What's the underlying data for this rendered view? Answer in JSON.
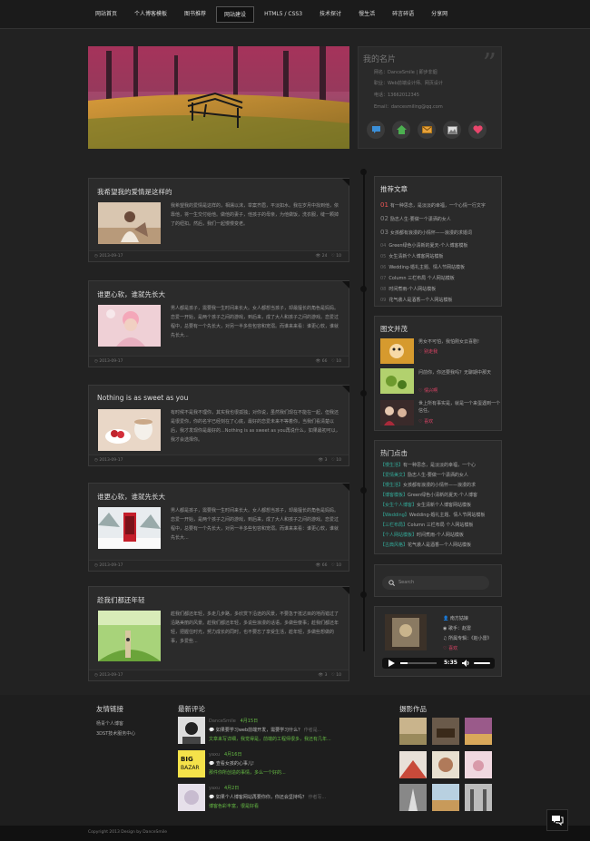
{
  "nav": {
    "items": [
      {
        "label": "网站首页"
      },
      {
        "label": "个人博客模板"
      },
      {
        "label": "图书推荐"
      },
      {
        "label": "网站建设"
      },
      {
        "label": "HTML5 / CSS3"
      },
      {
        "label": "技术探讨"
      },
      {
        "label": "慢生活"
      },
      {
        "label": "碎言碎语"
      },
      {
        "label": "分享网"
      }
    ],
    "active_index": 3
  },
  "profile": {
    "name": "我的名片",
    "lines": [
      "网名：DanceSmile | 即步非烟",
      "职业：Web前端设计师、网页设计",
      "电话：13662012345",
      "Email：dancesmiling@qq.com"
    ],
    "icons": [
      "chat-bubble-icon",
      "home-icon",
      "mail-icon",
      "photo-icon",
      "heart-icon"
    ]
  },
  "articles": [
    {
      "title": "我希望我的爱情是这样的",
      "text": "我希望我的爱情是这样的，相濡以沫，举案齐眉，平淡如水。我在岁月中找到他，依靠他，将一生交付给他。做他的妻子，他孩子的母亲，为他做饭，洗衣服，缝一颗掉了的纽扣。然后，我们一起慢慢变老。",
      "date": "2013-09-17",
      "views": "24",
      "comments": "10"
    },
    {
      "title": "谁更心软，谁就先长大",
      "text": "男人都是孩子，需要我一生时间来长大。女人都想当孩子，却最擅长的角色是妈妈。恋爱一开始，是两个孩子之间的游戏，到后来，成了大人和孩子之间的游戏。恋爱过程中，总要有一个先长大，对另一半多些包容和宠溺。而谁来来看：谁更心软，谁就先长大...",
      "date": "2013-09-17",
      "views": "66",
      "comments": "10"
    },
    {
      "title": "Nothing is as sweet as you",
      "text": "有时候不是我不理你，其实我也很孤独；对你说，虽然我们现在不能在一起，但我还是很爱你，你的名字已经刻在了心底，最好的恋爱未来不等着你，当我们看清楚以后，我才发现你是最好的...Nothing is as sweet as you再说什么，如果最初可以，我才会选择你。",
      "date": "2013-09-17",
      "views": "3",
      "comments": "10"
    },
    {
      "title": "谁更心软，谁就先长大",
      "text": "男人都是孩子，需要我一生时间来长大。女人都想当孩子，却最擅长的角色是妈妈。恋爱一开始，是两个孩子之间的游戏，到后来，成了大人和孩子之间的游戏。恋爱过程中，总要有一个先长大，对另一半多些包容和宠溺。而谁来来看：谁更心软，谁就先长大...",
      "date": "2013-09-17",
      "views": "66",
      "comments": "10"
    },
    {
      "title": "趁我们都还年轻",
      "text": "趁我们都还年轻，多走几步路，多欣赏下沿途的风景，不要急于抵达目的地而错过了沿路美丽的风景。趁我们都还年轻，多说些浪漫的话语，多做些傻事；趁我们都还年轻，把握住时光，努力成长的同时，也不要忘了享受生活，趁年轻，多做些想做的事，多爱些...",
      "date": "2013-09-17",
      "views": "3",
      "comments": "10"
    }
  ],
  "recommend": {
    "title": "推荐文章",
    "items": [
      {
        "n": "01",
        "text": "有一种思念，是淡淡的幸福，一个心情一行文字"
      },
      {
        "n": "02",
        "text": "励志人生-要做一个潇洒的女人"
      },
      {
        "n": "03",
        "text": "女孩都有浪漫的小情怀——浪漫的求婚词"
      },
      {
        "n": "04",
        "text": "Green绿色小清新的夏天-个人博客模板"
      },
      {
        "n": "05",
        "text": "女生清新个人博客网站模板"
      },
      {
        "n": "06",
        "text": "Wedding-婚礼主题、情人节网站模板"
      },
      {
        "n": "07",
        "text": "Column 三栏布局 个人网站模板"
      },
      {
        "n": "08",
        "text": "时间煮雨-个人网站模板"
      },
      {
        "n": "09",
        "text": "花气袭人是酒香—个人网站模板"
      }
    ]
  },
  "pictext": {
    "title": "图文并茂",
    "items": [
      {
        "text": "男女不可怕，我怕刚女云喜剧!",
        "tag": "别走我"
      },
      {
        "text": "问前你，你还要我吗？无聊期中那天",
        "tag": "情兴啊"
      },
      {
        "text": "世上所有事实是，就是一个来蛋遇到一个信任。",
        "tag": "喜欢"
      }
    ]
  },
  "hot": {
    "title": "热门点击",
    "items": [
      {
        "tag": "【慢生活】",
        "text": "有一种思念，是淡淡的幸福，一个心"
      },
      {
        "tag": "【爱情美文】",
        "text": "励志人生-要做一个潇洒的女人"
      },
      {
        "tag": "【慢生活】",
        "text": "女孩都有浪漫的小情怀——浪漫的求"
      },
      {
        "tag": "【博客模板】",
        "text": "Green绿色小清新的夏天-个人博客"
      },
      {
        "tag": "【女生个人博客】",
        "text": "女生清新个人博客网站模板"
      },
      {
        "tag": "【Wedding】",
        "text": "Wedding-婚礼主题、情人节网站模板"
      },
      {
        "tag": "【三栏布局】",
        "text": "Column 三栏布局 个人网站模板"
      },
      {
        "tag": "【个人网站模板】",
        "text": "时间煮雨-个人网站模板"
      },
      {
        "tag": "【古典风格】",
        "text": "花气袭人是酒香—个人网站模板"
      }
    ]
  },
  "search": {
    "placeholder": "Search"
  },
  "music": {
    "album": "南方姑娘",
    "singer": "歌手：赵雷",
    "record": "所属专辑：《赵小雷》",
    "like": "喜欢",
    "time": "5:35"
  },
  "footer": {
    "links_title": "友情链接",
    "links": [
      "杨青个人博客",
      "3DST技术服务中心"
    ],
    "comments_title": "最新评论",
    "comments": [
      {
        "name": "DanceSmile",
        "time": "4月15日",
        "text": "如果要学习web前端开发，需要学习什么？",
        "extra": "作者是...",
        "sub": "文章来写详细，我觉得是，前端的工程师很多，我还有几年..."
      },
      {
        "name": "yaxu",
        "time": "4月16日",
        "text": "查看女孩的心事儿!",
        "extra": "",
        "sub": "那件你所创造的事情，多么一个好的..."
      },
      {
        "name": "yaxu",
        "time": "4月2日",
        "text": "如果个人博客网站再要你你，你还会坚持吗？",
        "extra": "作者写...",
        "sub": "博客色彩丰富，很是好看"
      }
    ],
    "photos_title": "摄影作品"
  },
  "copyright": "Copyright 2013 Design by DanceSmile"
}
